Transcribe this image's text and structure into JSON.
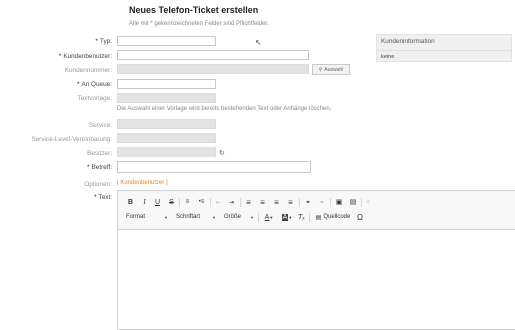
{
  "page": {
    "title": "Neues Telefon-Ticket erstellen",
    "hint": "Alle mit * gekennzeichneten Felder sind Pflichtfelder."
  },
  "form": {
    "star": "*",
    "typ_label": "Typ:",
    "kundenbenutzer_label": "Kundenbenutzer:",
    "kundennummer_label": "Kundennummer:",
    "auswahl_button": "Auswahl",
    "an_queue_label": "An Queue:",
    "textvorlage_label": "Textvorlage:",
    "template_note": "Die Auswahl einer Vorlage wird bereits bestehenden Text oder Anhänge löschen.",
    "service_label": "Service:",
    "sla_label": "Service-Level-Vereinbarung:",
    "besitzer_label": "Besitzer:",
    "betreff_label": "Betreff:",
    "optionen_label": "Optionen:",
    "optionen_link": "[ Kundenbenutzer ]",
    "text_label": "Text:"
  },
  "sidebar": {
    "title": "Kundeninformation",
    "value": "keine"
  },
  "editor": {
    "format_label": "Format",
    "schriftart_label": "Schriftart",
    "groesse_label": "Größe",
    "quellcode_label": "Quellcode",
    "icons": [
      "bold-icon",
      "italic-icon",
      "underline-icon",
      "strikethrough-icon",
      "ordered-list-icon",
      "bullet-list-icon",
      "outdent-icon",
      "indent-icon",
      "align-left-icon",
      "align-center-icon",
      "align-right-icon",
      "justify-icon",
      "link-icon",
      "unlink-icon",
      "image-icon",
      "table-icon",
      "add-icon",
      "text-color-icon",
      "background-color-icon",
      "remove-format-icon",
      "source-icon",
      "special-char-icon"
    ]
  }
}
